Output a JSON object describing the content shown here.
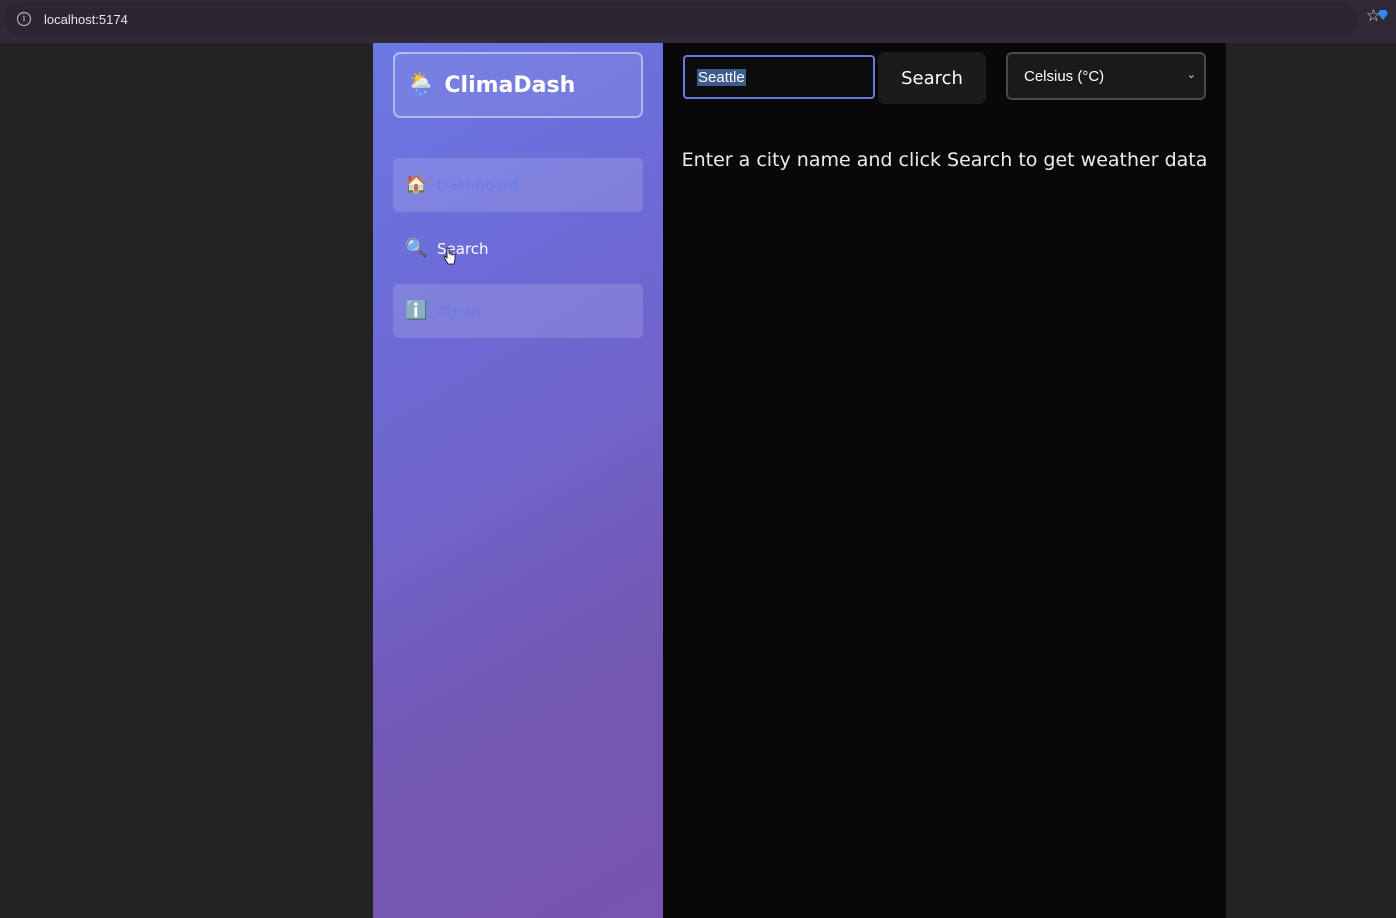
{
  "browser": {
    "url": "localhost:5174",
    "info_icon": "info-icon",
    "bookmark_icon": "star-icon"
  },
  "sidebar": {
    "logo_icon": "sun-behind-rain-cloud-icon",
    "logo_text": "ClimaDash",
    "items": [
      {
        "icon": "house-icon",
        "glyph": "🏠",
        "label": "Dashboard",
        "state": "faded"
      },
      {
        "icon": "magnifier-icon",
        "glyph": "🔍",
        "label": "Search",
        "state": "hovered"
      },
      {
        "icon": "info-icon",
        "glyph": "ℹ️",
        "label": "About",
        "state": "faded"
      }
    ]
  },
  "main": {
    "search": {
      "value": "Seattle",
      "button_label": "Search"
    },
    "unit_select": {
      "selected": "Celsius (°C)"
    },
    "hint": "Enter a city name and click Search to get weather data"
  },
  "colors": {
    "sidebar_gradient_start": "#6b78e3",
    "sidebar_gradient_end": "#7654b0",
    "input_focus_border": "#6b76e0",
    "main_background": "#080808"
  }
}
